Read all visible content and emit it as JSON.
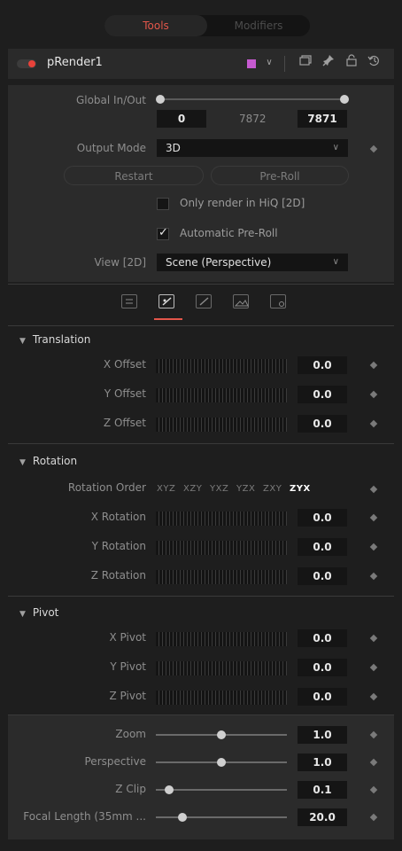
{
  "tabs": {
    "tools": "Tools",
    "modifiers": "Modifiers"
  },
  "node": {
    "name": "pRender1",
    "swatch_color": "#c65ad0"
  },
  "header_icons": [
    "swatch-dropdown-icon",
    "version-icon",
    "pin-icon",
    "lock-icon",
    "reset-icon"
  ],
  "global": {
    "label": "Global In/Out",
    "in_value": "0",
    "middle_value": "7872",
    "out_value": "7871"
  },
  "output_mode": {
    "label": "Output Mode",
    "value": "3D"
  },
  "buttons": {
    "restart": "Restart",
    "preroll": "Pre-Roll"
  },
  "checkboxes": {
    "hiq": {
      "label": "Only render in HiQ [2D]",
      "checked": false
    },
    "auto_preroll": {
      "label": "Automatic Pre-Roll",
      "checked": true
    }
  },
  "view": {
    "label": "View [2D]",
    "value": "Scene (Perspective)"
  },
  "translation": {
    "title": "Translation",
    "x": {
      "label": "X Offset",
      "value": "0.0"
    },
    "y": {
      "label": "Y Offset",
      "value": "0.0"
    },
    "z": {
      "label": "Z Offset",
      "value": "0.0"
    }
  },
  "rotation": {
    "title": "Rotation",
    "order_label": "Rotation Order",
    "orders": [
      "XYZ",
      "XZY",
      "YXZ",
      "YZX",
      "ZXY",
      "ZYX"
    ],
    "selected_order": "ZYX",
    "x": {
      "label": "X Rotation",
      "value": "0.0"
    },
    "y": {
      "label": "Y Rotation",
      "value": "0.0"
    },
    "z": {
      "label": "Z Rotation",
      "value": "0.0"
    }
  },
  "pivot": {
    "title": "Pivot",
    "x": {
      "label": "X Pivot",
      "value": "0.0"
    },
    "y": {
      "label": "Y Pivot",
      "value": "0.0"
    },
    "z": {
      "label": "Z Pivot",
      "value": "0.0"
    }
  },
  "camera": {
    "zoom": {
      "label": "Zoom",
      "value": "1.0",
      "level": 0.5
    },
    "perspective": {
      "label": "Perspective",
      "value": "1.0",
      "level": 0.5
    },
    "zclip": {
      "label": "Z Clip",
      "value": "0.1",
      "level": 0.1
    },
    "focal": {
      "label": "Focal Length (35mm ...",
      "value": "20.0",
      "level": 0.2
    }
  }
}
